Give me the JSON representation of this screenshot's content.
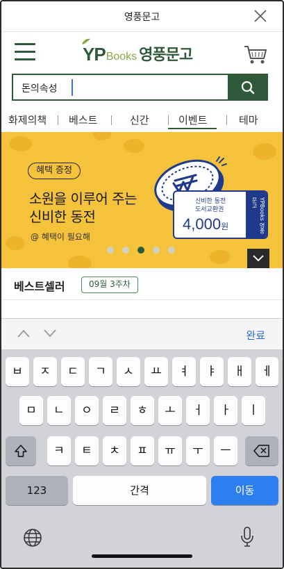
{
  "header": {
    "title": "영풍문고"
  },
  "logo": {
    "yp": "YP",
    "books": "Books",
    "korean": "영풍문고"
  },
  "search": {
    "value": "돈의속성"
  },
  "nav": {
    "items": [
      "화제의책",
      "베스트",
      "신간",
      "이벤트",
      "테마"
    ]
  },
  "banner": {
    "pill": "혜택 증정",
    "headline_line1": "소원을 이루어 주는",
    "headline_line2": "신비한 동전",
    "sub": "@ 혜택이 필요해",
    "ticket_line1": "신비한 동전",
    "ticket_line2": "도서교환권",
    "ticket_amount": "4,000",
    "ticket_unit": "원",
    "ticket_stub": "YPBooks 영풍문고",
    "slide_count": 5,
    "active_slide": 3
  },
  "bestseller": {
    "label": "베스트셀러",
    "week": "09월 3주차"
  },
  "keyboard": {
    "done": "완료",
    "row1": [
      "ㅂ",
      "ㅈ",
      "ㄷ",
      "ㄱ",
      "ㅅ",
      "ㅛ",
      "ㅕ",
      "ㅑ",
      "ㅐ",
      "ㅔ"
    ],
    "row2": [
      "ㅁ",
      "ㄴ",
      "ㅇ",
      "ㄹ",
      "ㅎ",
      "ㅗ",
      "ㅓ",
      "ㅏ",
      "ㅣ"
    ],
    "row3": [
      "ㅋ",
      "ㅌ",
      "ㅊ",
      "ㅍ",
      "ㅠ",
      "ㅜ",
      "ㅡ"
    ],
    "numbers": "123",
    "space": "간격",
    "go": "이동"
  },
  "colors": {
    "brand_green": "#2f5a3a",
    "banner_yellow": "#f4c33b",
    "ticket_blue": "#1f3a8a",
    "ios_blue": "#2d7ff0"
  }
}
